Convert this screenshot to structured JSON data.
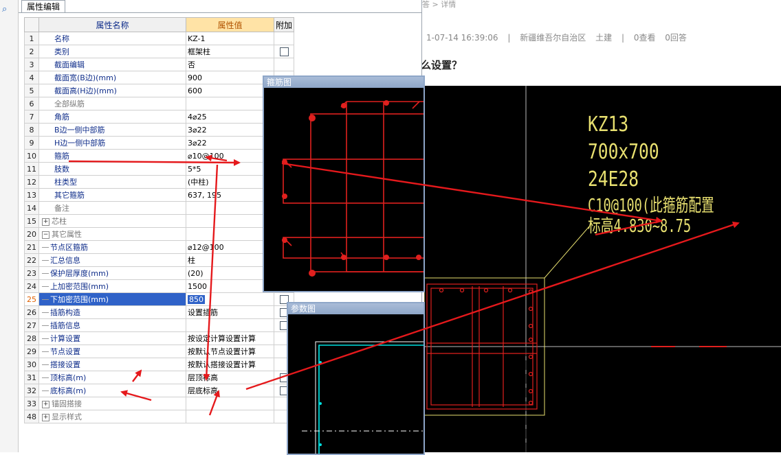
{
  "webpage": {
    "breadcrumb": "答 > 详情",
    "meta_time": "1-07-14 16:39:06",
    "meta_region": "新疆维吾尔自治区",
    "meta_major": "土建",
    "meta_views": "0查看",
    "meta_answers": "0回答",
    "question_title": "么设置？"
  },
  "cad": {
    "label1": "KZ13",
    "label2": "700x700",
    "label3": "24E28",
    "label4": "C10@100(此箍筋配置标高4.830~8.75"
  },
  "editor": {
    "tab_label": "属性编辑",
    "col_name": "属性名称",
    "col_value": "属性值",
    "col_extra": "附加",
    "rows": [
      {
        "num": "1",
        "name": "名称",
        "value": "KZ-1",
        "cb": false
      },
      {
        "num": "2",
        "name": "类别",
        "value": "框架柱",
        "cb": true
      },
      {
        "num": "3",
        "name": "截面编辑",
        "value": "否",
        "cb": false
      },
      {
        "num": "4",
        "name": "截面宽(B边)(mm)",
        "value": "900",
        "cb": false
      },
      {
        "num": "5",
        "name": "截面高(H边)(mm)",
        "value": "600",
        "cb": false
      },
      {
        "num": "6",
        "name": "全部纵筋",
        "value": "",
        "cb": false
      },
      {
        "num": "7",
        "name": "角筋",
        "value": "4⌀25",
        "cb": false
      },
      {
        "num": "8",
        "name": "B边一侧中部筋",
        "value": "3⌀22",
        "cb": false
      },
      {
        "num": "9",
        "name": "H边一侧中部筋",
        "value": "3⌀22",
        "cb": false
      },
      {
        "num": "10",
        "name": "箍筋",
        "value": "⌀10@100",
        "cb": false
      },
      {
        "num": "11",
        "name": "肢数",
        "value": "5*5",
        "cb": false
      },
      {
        "num": "12",
        "name": "柱类型",
        "value": "(中柱)",
        "cb": false
      },
      {
        "num": "13",
        "name": "其它箍筋",
        "value": "637, 195",
        "cb": false
      },
      {
        "num": "14",
        "name": "备注",
        "value": "",
        "cb": false
      },
      {
        "num": "15",
        "name": "芯柱",
        "value": "",
        "cb": false
      },
      {
        "num": "20",
        "name": "其它属性",
        "value": "",
        "cb": false
      },
      {
        "num": "21",
        "name": "节点区箍筋",
        "value": "⌀12@100",
        "cb": false
      },
      {
        "num": "22",
        "name": "汇总信息",
        "value": "柱",
        "cb": false
      },
      {
        "num": "23",
        "name": "保护层厚度(mm)",
        "value": "(20)",
        "cb": false
      },
      {
        "num": "24",
        "name": "上加密范围(mm)",
        "value": "1500",
        "cb": false
      },
      {
        "num": "25",
        "name": "下加密范围(mm)",
        "value": "850",
        "cb": true
      },
      {
        "num": "26",
        "name": "插筋构造",
        "value": "设置插筋",
        "cb": true
      },
      {
        "num": "27",
        "name": "插筋信息",
        "value": "",
        "cb": true
      },
      {
        "num": "28",
        "name": "计算设置",
        "value": "按设定计算设置计算",
        "cb": false
      },
      {
        "num": "29",
        "name": "节点设置",
        "value": "按默认节点设置计算",
        "cb": false
      },
      {
        "num": "30",
        "name": "搭接设置",
        "value": "按默认搭接设置计算",
        "cb": false
      },
      {
        "num": "31",
        "name": "顶标高(m)",
        "value": "层顶标高",
        "cb": true
      },
      {
        "num": "32",
        "name": "底标高(m)",
        "value": "层底标高",
        "cb": true
      },
      {
        "num": "33",
        "name": "锚固搭接",
        "value": "",
        "cb": false
      },
      {
        "num": "48",
        "name": "显示样式",
        "value": "",
        "cb": false
      }
    ]
  },
  "stirrup_window": {
    "title": "箍筋图"
  },
  "param_window": {
    "title": "参数图"
  },
  "colors": {
    "annotation": "#e5191c",
    "selection": "#2f62c8",
    "header_value": "#ffe3a6",
    "cad_text": "#e8e070",
    "rebar": "#e0201e",
    "cyan": "#00e0e0"
  }
}
